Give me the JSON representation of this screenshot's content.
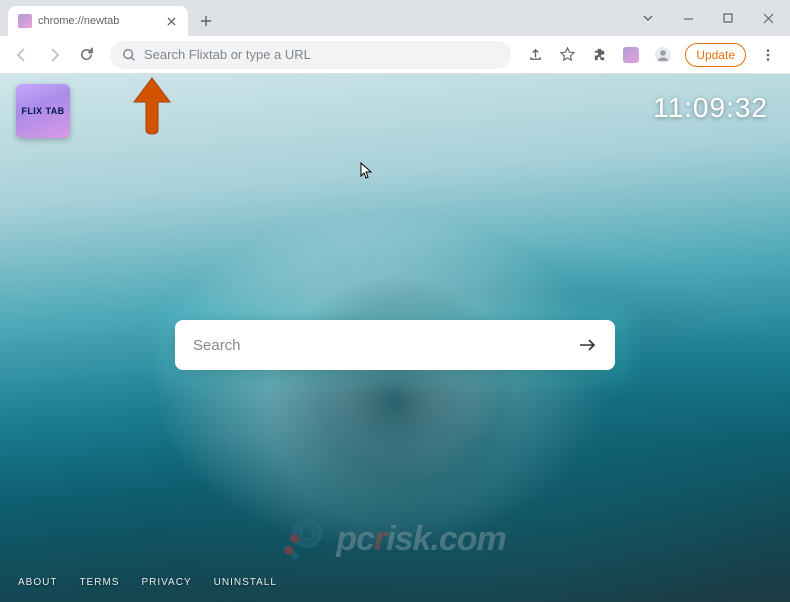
{
  "tab": {
    "title": "chrome://newtab"
  },
  "toolbar": {
    "omnibox_placeholder": "Search Flixtab or type a URL",
    "update_label": "Update"
  },
  "page": {
    "tile_label": "FLIX TAB",
    "clock": "11:09:32",
    "search_placeholder": "Search",
    "footer": {
      "about": "ABOUT",
      "terms": "TERMS",
      "privacy": "PRIVACY",
      "uninstall": "UNINSTALL"
    }
  },
  "watermark": {
    "text_left": "pc",
    "text_mid": "r",
    "text_right": "isk.com"
  }
}
